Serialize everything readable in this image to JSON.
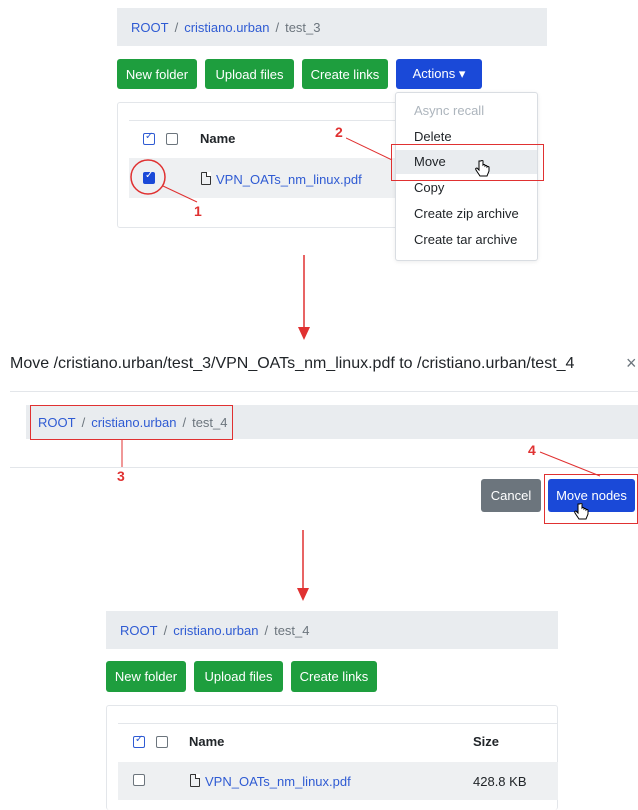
{
  "step1": {
    "breadcrumb": {
      "root": "ROOT",
      "sep": "/",
      "user": "cristiano.urban",
      "current": "test_3"
    },
    "buttons": {
      "new_folder": "New folder",
      "upload": "Upload files",
      "create_links": "Create links",
      "actions": "Actions ▾"
    },
    "table": {
      "name_header": "Name",
      "file": "VPN_OATs_nm_linux.pdf"
    },
    "menu": [
      "Async recall",
      "Delete",
      "Move",
      "Copy",
      "Create zip archive",
      "Create tar archive"
    ],
    "annotations": {
      "one": "1",
      "two": "2"
    }
  },
  "step2": {
    "title": "Move /cristiano.urban/test_3/VPN_OATs_nm_linux.pdf to /cristiano.urban/test_4",
    "close": "×",
    "breadcrumb": {
      "root": "ROOT",
      "sep": "/",
      "user": "cristiano.urban",
      "current": "test_4"
    },
    "buttons": {
      "cancel": "Cancel",
      "move": "Move nodes"
    },
    "annotations": {
      "three": "3",
      "four": "4"
    }
  },
  "step3": {
    "breadcrumb": {
      "root": "ROOT",
      "sep": "/",
      "user": "cristiano.urban",
      "current": "test_4"
    },
    "buttons": {
      "new_folder": "New folder",
      "upload": "Upload files",
      "create_links": "Create links"
    },
    "table": {
      "name_header": "Name",
      "size_header": "Size",
      "file": "VPN_OATs_nm_linux.pdf",
      "size": "428.8 KB"
    }
  },
  "colors": {
    "accent": "#1a49d8",
    "success": "#1e9e3e",
    "annotation": "#e03131"
  }
}
